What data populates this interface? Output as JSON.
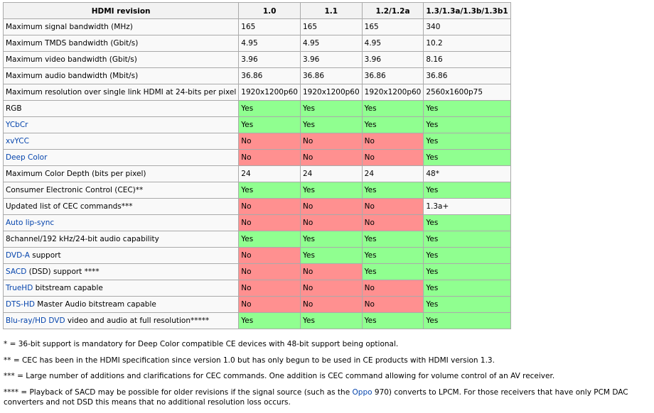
{
  "table": {
    "headers": [
      "HDMI revision",
      "1.0",
      "1.1",
      "1.2/1.2a",
      "1.3/1.3a/1.3b/1.3b1"
    ],
    "rows": [
      {
        "label": [
          "Maximum signal bandwidth (MHz)"
        ],
        "cells": [
          "165",
          "165",
          "165",
          "340"
        ]
      },
      {
        "label": [
          "Maximum TMDS bandwidth (Gbit/s)"
        ],
        "cells": [
          "4.95",
          "4.95",
          "4.95",
          "10.2"
        ]
      },
      {
        "label": [
          "Maximum video bandwidth (Gbit/s)"
        ],
        "cells": [
          "3.96",
          "3.96",
          "3.96",
          "8.16"
        ]
      },
      {
        "label": [
          "Maximum audio bandwidth (Mbit/s)"
        ],
        "cells": [
          "36.86",
          "36.86",
          "36.86",
          "36.86"
        ]
      },
      {
        "label": [
          "Maximum resolution over single link HDMI at 24-bits per pixel"
        ],
        "cells": [
          "1920x1200p60",
          "1920x1200p60",
          "1920x1200p60",
          "2560x1600p75"
        ]
      },
      {
        "label": [
          "RGB"
        ],
        "cells": [
          "Yes",
          "Yes",
          "Yes",
          "Yes"
        ]
      },
      {
        "label": [
          "YCbCr"
        ],
        "link": true,
        "cells": [
          "Yes",
          "Yes",
          "Yes",
          "Yes"
        ]
      },
      {
        "label": [
          "xvYCC"
        ],
        "link": true,
        "cells": [
          "No",
          "No",
          "No",
          "Yes"
        ]
      },
      {
        "label": [
          "Deep Color"
        ],
        "link": true,
        "cells": [
          "No",
          "No",
          "No",
          "Yes"
        ]
      },
      {
        "label": [
          "Maximum Color Depth (bits per pixel)"
        ],
        "cells": [
          "24",
          "24",
          "24",
          "48*"
        ]
      },
      {
        "label": [
          "Consumer Electronic Control (CEC)**"
        ],
        "cells": [
          "Yes",
          "Yes",
          "Yes",
          "Yes"
        ]
      },
      {
        "label": [
          "Updated list of CEC commands***"
        ],
        "cells": [
          "No",
          "No",
          "No",
          "1.3a+"
        ]
      },
      {
        "label": [
          "Auto lip-sync"
        ],
        "link": true,
        "cells": [
          "No",
          "No",
          "No",
          "Yes"
        ]
      },
      {
        "label": [
          "8channel/192 kHz/24-bit audio capability"
        ],
        "cells": [
          "Yes",
          "Yes",
          "Yes",
          "Yes"
        ]
      },
      {
        "label": [
          "DVD-A",
          " support"
        ],
        "link": true,
        "cells": [
          "No",
          "Yes",
          "Yes",
          "Yes"
        ]
      },
      {
        "label": [
          "SACD",
          " (DSD) support ****"
        ],
        "link": true,
        "cells": [
          "No",
          "No",
          "Yes",
          "Yes"
        ]
      },
      {
        "label": [
          "TrueHD",
          " bitstream capable"
        ],
        "link": true,
        "cells": [
          "No",
          "No",
          "No",
          "Yes"
        ]
      },
      {
        "label": [
          "DTS-HD",
          " Master Audio bitstream capable"
        ],
        "link": true,
        "cells": [
          "No",
          "No",
          "No",
          "Yes"
        ]
      },
      {
        "label": [
          "Blu-ray/HD DVD",
          " video and audio at full resolution*****"
        ],
        "link": true,
        "cells": [
          "Yes",
          "Yes",
          "Yes",
          "Yes"
        ]
      }
    ]
  },
  "footnotes": [
    {
      "parts": [
        "* = 36-bit support is mandatory for Deep Color compatible CE devices with 48-bit support being optional."
      ]
    },
    {
      "parts": [
        "** = CEC has been in the HDMI specification since version 1.0 but has only begun to be used in CE products with HDMI version 1.3."
      ]
    },
    {
      "parts": [
        "*** = Large number of additions and clarifications for CEC commands. One addition is CEC command allowing for volume control of an AV receiver."
      ]
    },
    {
      "parts": [
        "**** = Playback of SACD may be possible for older revisions if the signal source (such as the ",
        "Oppo",
        " 970) converts to LPCM. For those receivers that have only PCM DAC converters and not DSD this means that no additional resolution loss occurs."
      ],
      "link_index": 1
    }
  ],
  "colors": {
    "yes": "#90ff90",
    "no": "#ff9090",
    "link": "#0645ad",
    "header_bg": "#f2f2f2",
    "border": "#aaaaaa"
  }
}
